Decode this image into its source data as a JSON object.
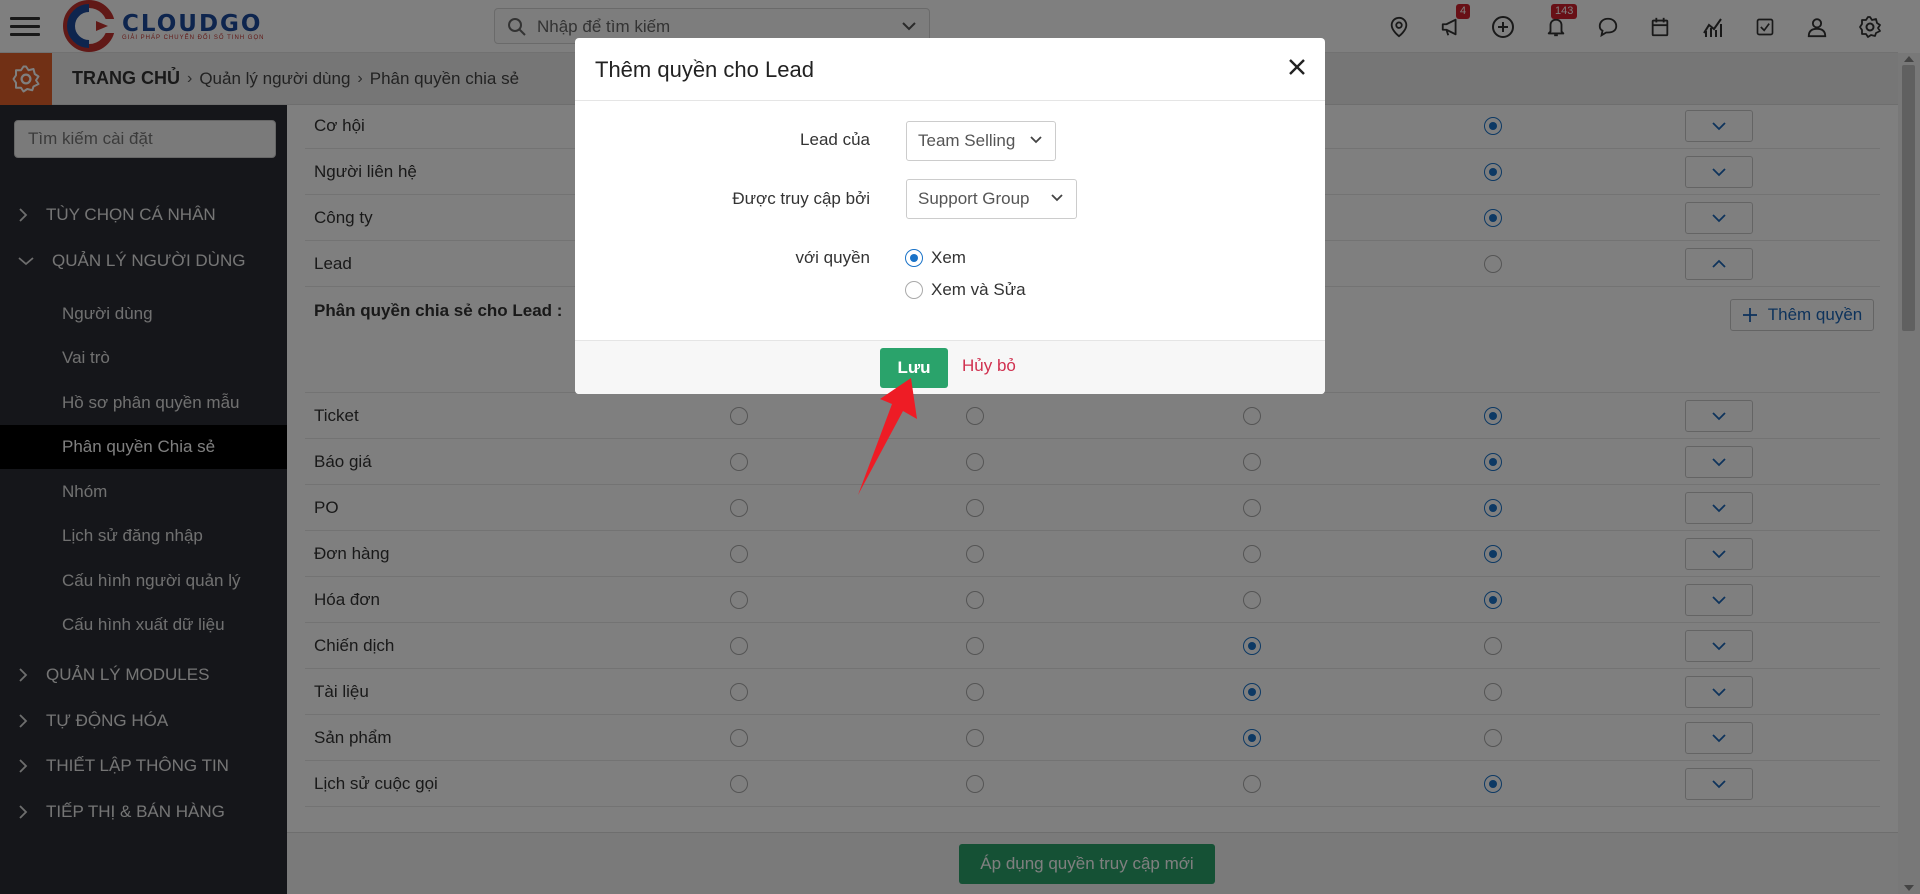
{
  "header": {
    "logo_title": "CLOUDGO",
    "logo_subtitle": "GIẢI PHÁP CHUYỂN ĐỔI SỐ TINH GỌN",
    "search_placeholder": "Nhập để tìm kiếm",
    "icons": [
      "location-icon",
      "megaphone-icon",
      "plus-circle-icon",
      "bell-icon",
      "chat-icon",
      "calendar-icon",
      "chart-icon",
      "checkbox-icon",
      "user-icon",
      "settings-icon"
    ],
    "megaphone_badge": "4",
    "bell_badge": "143"
  },
  "breadcrumb": {
    "home": "TRANG CHỦ",
    "level1": "Quản lý người dùng",
    "level2": "Phân quyền chia sẻ"
  },
  "sidebar": {
    "search_placeholder": "Tìm kiếm cài đặt",
    "groups": [
      {
        "label": "TÙY CHỌN CÁ NHÂN",
        "expanded": false
      },
      {
        "label": "QUẢN LÝ NGƯỜI DÙNG",
        "expanded": true
      },
      {
        "label": "QUẢN LÝ MODULES",
        "expanded": false
      },
      {
        "label": "TỰ ĐỘNG HÓA",
        "expanded": false
      },
      {
        "label": "THIẾT LẬP THÔNG TIN",
        "expanded": false
      },
      {
        "label": "TIẾP THỊ & BÁN HÀNG",
        "expanded": false
      }
    ],
    "items": [
      {
        "label": "Người dùng",
        "active": false
      },
      {
        "label": "Vai trò",
        "active": false
      },
      {
        "label": "Hồ sơ phân quyền mẫu",
        "active": false
      },
      {
        "label": "Phân quyền Chia sẻ",
        "active": true
      },
      {
        "label": "Nhóm",
        "active": false
      },
      {
        "label": "Lịch sử đăng nhập",
        "active": false
      },
      {
        "label": "Cấu hình người quản lý",
        "active": false
      },
      {
        "label": "Cấu hình xuất dữ liệu",
        "active": false
      }
    ]
  },
  "main": {
    "rows_top": [
      {
        "label": "Cơ hội",
        "selected": 3,
        "expanded": false
      },
      {
        "label": "Người liên hệ",
        "selected": 3,
        "expanded": false
      },
      {
        "label": "Công ty",
        "selected": 3,
        "expanded": false
      },
      {
        "label": "Lead",
        "selected": -1,
        "expanded": true
      }
    ],
    "subhead": "Phân quyền chia sẻ cho Lead :",
    "add_permission": "Thêm quyền",
    "rows_bottom": [
      {
        "label": "Ticket",
        "selected": 3
      },
      {
        "label": "Báo giá",
        "selected": 3
      },
      {
        "label": "PO",
        "selected": 3
      },
      {
        "label": "Đơn hàng",
        "selected": 3
      },
      {
        "label": "Hóa đơn",
        "selected": 3
      },
      {
        "label": "Chiến dịch",
        "selected": 2
      },
      {
        "label": "Tài liệu",
        "selected": 2
      },
      {
        "label": "Sản phẩm",
        "selected": 2
      },
      {
        "label": "Lịch sử cuộc gọi",
        "selected": 3
      }
    ],
    "apply_button": "Áp dụng quyền truy cập mới"
  },
  "modal": {
    "title": "Thêm quyền cho Lead",
    "lead_of_label": "Lead của",
    "lead_of_value": "Team Selling",
    "accessed_by_label": "Được truy cập bởi",
    "accessed_by_value": "Support Group",
    "permission_label": "với quyền",
    "options": [
      {
        "label": "Xem",
        "checked": true
      },
      {
        "label": "Xem và Sửa",
        "checked": false
      }
    ],
    "save_button": "Lưu",
    "cancel_button": "Hủy bỏ"
  },
  "colors": {
    "accent_orange": "#e2612b",
    "sidebar_bg": "#2a2d35",
    "primary_green": "#2aa36b",
    "radio_blue": "#1a73c8",
    "badge_red": "#d0212c",
    "cancel_red": "#d0304f",
    "arrow_red": "#ee1c25"
  }
}
